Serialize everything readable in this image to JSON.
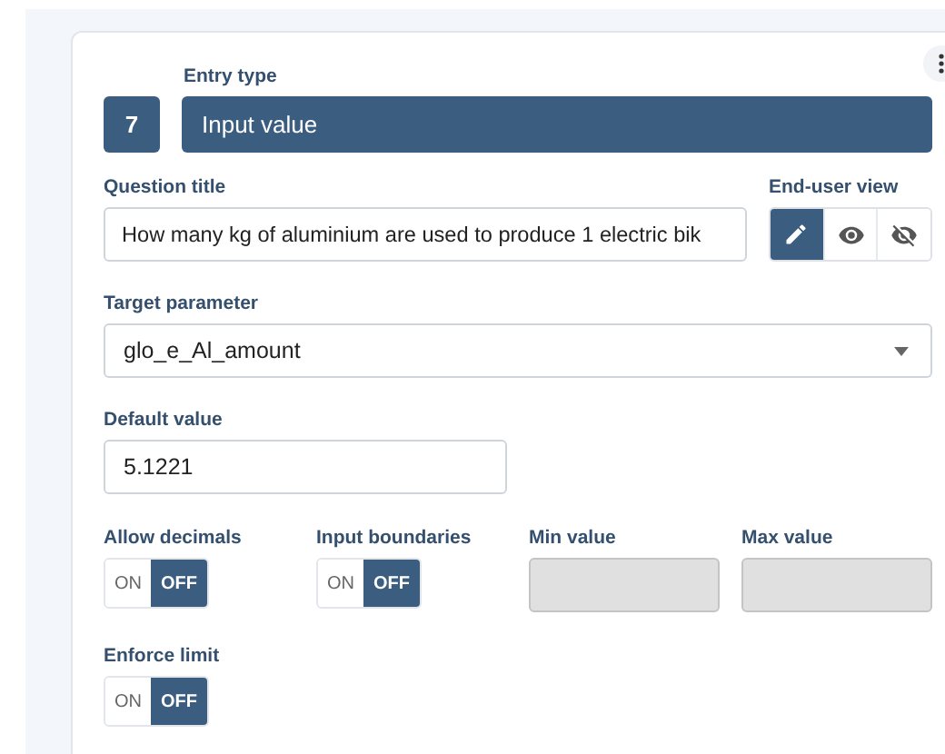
{
  "entry": {
    "label": "Entry type",
    "number": "7",
    "value": "Input value"
  },
  "question": {
    "label": "Question title",
    "value": "How many kg of aluminium are used to produce 1 electric bik"
  },
  "end_user_view": {
    "label": "End-user view",
    "modes": [
      {
        "kind": "edit",
        "selected": true
      },
      {
        "kind": "view",
        "selected": false
      },
      {
        "kind": "hidden",
        "selected": false
      }
    ]
  },
  "target_parameter": {
    "label": "Target parameter",
    "value": "glo_e_Al_amount"
  },
  "default_value": {
    "label": "Default value",
    "value": "5.1221"
  },
  "toggles": [
    {
      "label": "Allow decimals",
      "on": false,
      "on_text": "ON",
      "off_text": "OFF"
    },
    {
      "label": "Input boundaries",
      "on": false,
      "on_text": "ON",
      "off_text": "OFF"
    }
  ],
  "bounds": [
    {
      "label": "Min value",
      "disabled": true
    },
    {
      "label": "Max value",
      "disabled": true
    }
  ],
  "enforce_limit": {
    "label": "Enforce limit",
    "on": false,
    "on_text": "ON",
    "off_text": "OFF"
  }
}
